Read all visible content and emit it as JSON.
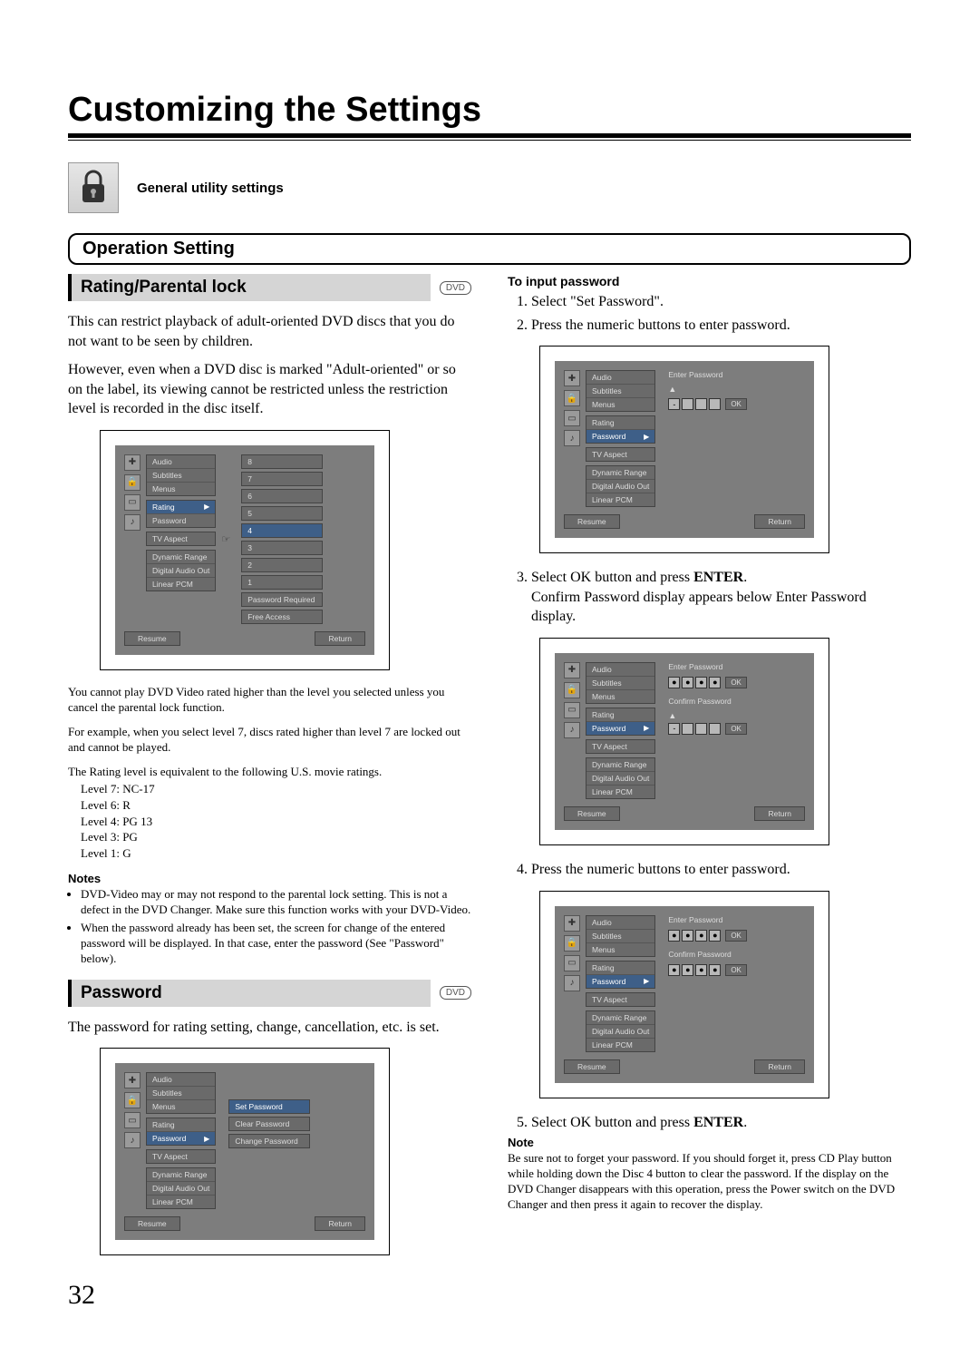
{
  "page_number": "32",
  "title": "Customizing the Settings",
  "subtitle": "General utility settings",
  "operation_heading": "Operation Setting",
  "dvd_badge": "DVD",
  "left": {
    "rating_heading": "Rating/Parental lock",
    "rating_p1": "This can restrict playback of adult-oriented DVD discs that you do not want to be seen by children.",
    "rating_p2": "However, even when a DVD disc is marked \"Adult-oriented\" or so on the label, its viewing cannot be restricted unless the restriction level is recorded in the disc itself.",
    "rating_note1": "You cannot play DVD Video rated higher than the level you selected unless you cancel the parental lock function.",
    "rating_note2": "For example, when you select level 7, discs rated higher than level 7 are locked out and cannot be played.",
    "rating_equiv": "The Rating level is equivalent to the following U.S. movie ratings.",
    "levels": [
      "Level 7:  NC-17",
      "Level 6:  R",
      "Level 4:  PG 13",
      "Level 3:  PG",
      "Level 1:  G"
    ],
    "notes_heading": "Notes",
    "notes": [
      "DVD-Video may or may not respond to the parental lock setting. This is not a defect in the DVD Changer. Make sure this function works with your DVD-Video.",
      "When the password already has been set, the screen for change of the entered password will be displayed. In that case, enter the password (See \"Password\" below)."
    ],
    "password_heading": "Password",
    "password_p1": "The password for rating setting, change, cancellation, etc. is set."
  },
  "right": {
    "input_heading": "To input password",
    "step1": "Select \"Set Password\".",
    "step2": "Press the numeric buttons to enter password.",
    "step3a": "Select OK button and press ",
    "step3b": "ENTER",
    "step3c": ".",
    "step3d": "Confirm Password display appears below Enter Password display.",
    "step4": "Press the numeric buttons to enter password.",
    "step5a": "Select OK button and press ",
    "step5b": "ENTER",
    "step5c": ".",
    "note_heading": "Note",
    "note_body": "Be sure not to forget your password. If you should forget it, press CD Play button while holding down the Disc 4 button to clear the password. If the display on the DVD Changer disappears with this operation, press the Power switch on the DVD Changer and then press it again to recover the display."
  },
  "osd": {
    "groups": [
      [
        "Audio",
        "Subtitles",
        "Menus"
      ],
      [
        "Rating",
        "Password"
      ],
      [
        "TV Aspect"
      ],
      [
        "Dynamic Range",
        "Digital Audio Out",
        "Linear PCM"
      ]
    ],
    "resume": "Resume",
    "return": "Return",
    "ok": "OK",
    "levels": [
      "8",
      "7",
      "6",
      "5",
      "4",
      "3",
      "2",
      "1"
    ],
    "pw_req": "Password Required",
    "free_access": "Free Access",
    "set_pw": "Set Password",
    "clear_pw": "Clear Password",
    "change_pw": "Change Password",
    "enter_pw": "Enter Password",
    "confirm_pw": "Confirm Password"
  }
}
